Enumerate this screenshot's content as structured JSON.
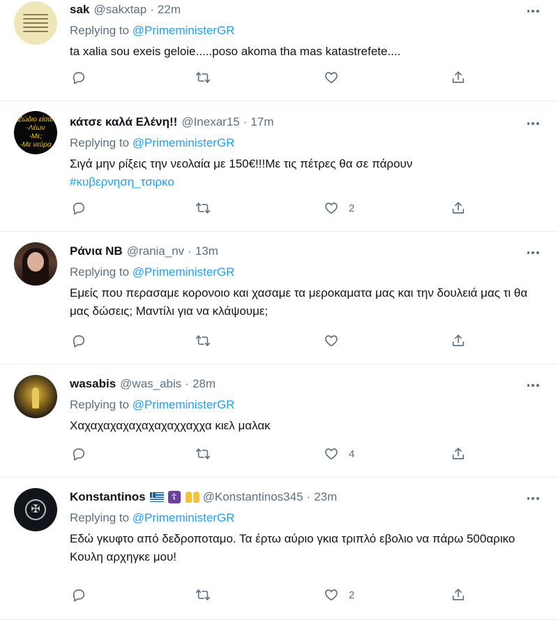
{
  "tweets": [
    {
      "name": "sak",
      "handle": "@sakxtap",
      "time": "22m",
      "reply_label": "Replying to",
      "reply_mention": "@PrimeministerGR",
      "text": "ta xalia sou exeis geloie.....poso akoma tha mas katastrefete....",
      "hashtag": "",
      "likes": "",
      "avatar": "text-card-avatar"
    },
    {
      "name": "κάτσε καλά Ελένη!!",
      "handle": "@Inexar15",
      "time": "17m",
      "reply_label": "Replying to",
      "reply_mention": "@PrimeministerGR",
      "text": "Σιγά μην ρίξεις την νεολαία με 150€!!!Με τις πέτρες θα σε πάρουν",
      "hashtag": "#κυβερνηση_τσιρκο",
      "likes": "2",
      "avatar_text": [
        "Ζώδιο είσαι",
        "-Λέων",
        "-Με;",
        "-Με νεύρα"
      ]
    },
    {
      "name": "Ράνια ΝΒ",
      "handle": "@rania_nv",
      "time": "13m",
      "reply_label": "Replying to",
      "reply_mention": "@PrimeministerGR",
      "text": "Εμείς που περασαμε κορονοιο και χασαμε τα μεροκαματα μας και την δουλειά μας τι θα μας δώσεις; Μαντίλι για να κλάψουμε;",
      "hashtag": "",
      "likes": "",
      "avatar": "portrait-avatar"
    },
    {
      "name": "wasabis",
      "handle": "@was_abis",
      "time": "28m",
      "reply_label": "Replying to",
      "reply_mention": "@PrimeministerGR",
      "text": "Χαχαχαχαχαχαχαχαχχαχχα κιελ μαλακ",
      "hashtag": "",
      "likes": "4",
      "avatar": "golden-icon-avatar"
    },
    {
      "name": "Konstantinos",
      "handle": "@Konstantinos345",
      "time": "23m",
      "reply_label": "Replying to",
      "reply_mention": "@PrimeministerGR",
      "text": "Εδώ γκυφτο από δεδροποταμο. Τα έρτω αύριο γκια τριπλό εβολιο να πάρω 500αρικο Κουλη αρχηγκε μου!",
      "hashtag": "",
      "likes": "2",
      "avatar": "emblem-avatar",
      "name_emojis": [
        "greek-flag-icon",
        "orthodox-cross-icon",
        "family-icon"
      ]
    }
  ],
  "icons": {
    "reply": "reply-icon",
    "retweet": "retweet-icon",
    "like": "heart-icon",
    "share": "share-icon",
    "more": "more-icon"
  },
  "colors": {
    "link": "#1da1f2",
    "secondary_text": "#5b7083",
    "divider": "#e6ecf0"
  }
}
